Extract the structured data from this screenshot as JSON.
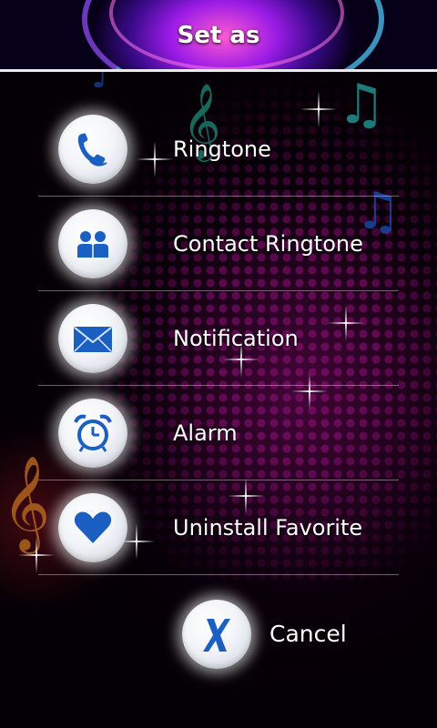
{
  "header": {
    "title": "Set as"
  },
  "menu": {
    "items": [
      {
        "label": "Ringtone",
        "icon": "phone-icon"
      },
      {
        "label": "Contact Ringtone",
        "icon": "contacts-icon"
      },
      {
        "label": "Notification",
        "icon": "envelope-icon"
      },
      {
        "label": "Alarm",
        "icon": "alarm-clock-icon"
      },
      {
        "label": "Uninstall Favorite",
        "icon": "heart-icon"
      }
    ]
  },
  "cancel": {
    "label": "Cancel",
    "icon": "x-icon"
  },
  "colors": {
    "icon_blue": "#1b5fc2",
    "text": "#ffffff",
    "divider": "#d8d8d8",
    "header_border": "#e9e9ee"
  }
}
